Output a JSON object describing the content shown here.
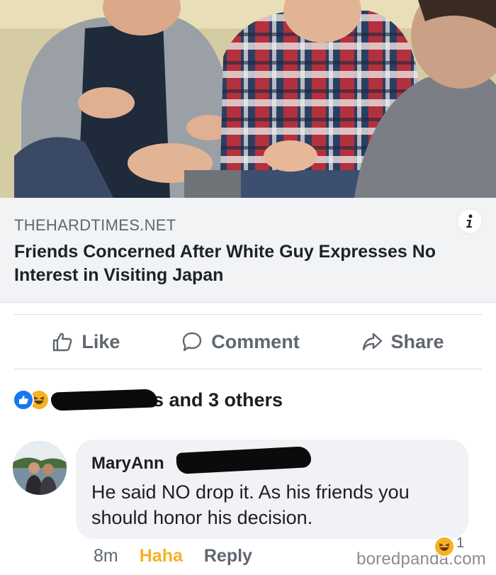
{
  "link_preview": {
    "domain": "THEHARDTIMES.NET",
    "headline": "Friends Concerned After White Guy Expresses No Interest in Visiting Japan",
    "image_icon": "photo-of-three-men-talking",
    "info_icon": "info-icon"
  },
  "actions": {
    "like_label": "Like",
    "comment_label": "Comment",
    "share_label": "Share",
    "like_icon": "thumbs-up-icon",
    "comment_icon": "speech-bubble-icon",
    "share_icon": "share-arrow-icon"
  },
  "reactions": {
    "summary_text": "s and 3 others",
    "icons": [
      "like-reaction-icon",
      "haha-reaction-icon"
    ]
  },
  "comment": {
    "author": "MaryAnn",
    "text": "He said NO drop it. As his friends you should honor his decision.",
    "time": "8m",
    "haha_label": "Haha",
    "reply_label": "Reply",
    "reaction_count": "1"
  },
  "watermark": "boredpanda.com",
  "colors": {
    "facebook_blue": "#1877f2",
    "haha_yellow": "#f7b125",
    "meta_gray": "#606770",
    "link_bg": "#f2f3f5",
    "bubble_bg": "#f0f2f5"
  }
}
